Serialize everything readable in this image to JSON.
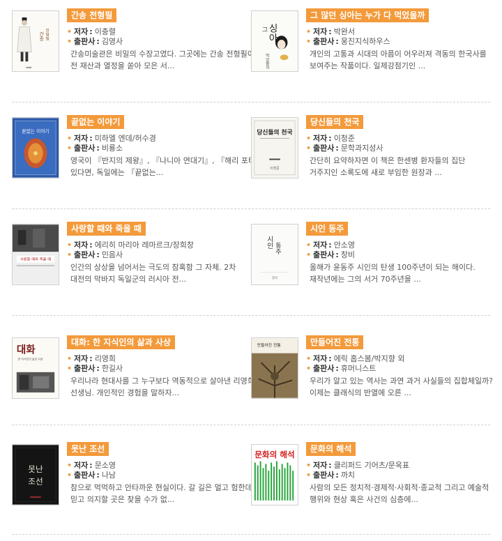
{
  "labels": {
    "author": "저자",
    "publisher": "출판사"
  },
  "books": [
    {
      "title": "간송 전형필",
      "author": "이충렬",
      "publisher": "김영사",
      "desc": [
        "간송미술관은 비밀의 수장고였다. 그곳에는 간송 전형필이",
        "전 재산과 열정을 쏟아 모은 서..."
      ],
      "cover": {
        "type": "gansong",
        "text": "간송 전형필"
      }
    },
    {
      "title": "그 많던 싱아는 누가 다 먹었을까",
      "author": "박완서",
      "publisher": "웅진지식하우스",
      "desc": [
        "개인의 고통과 시대의 아픔이 어우러져 격동의 한국사를",
        "보여주는 작품이다. 일제강점기인 ..."
      ],
      "cover": {
        "type": "singa",
        "text": "싱아"
      }
    },
    {
      "title": "끝없는 이야기",
      "author": "미하엘 엔데/허수경",
      "publisher": "비룡소",
      "desc": [
        "영국이 『반지의 제왕』, 『나니아 연대기』, 『해리 포터』가",
        "있다면, 독일에는 『끝없는..."
      ],
      "cover": {
        "type": "endless",
        "text": "끝없는 이야기"
      }
    },
    {
      "title": "당신들의 천국",
      "author": "이청준",
      "publisher": "문학과지성사",
      "desc": [
        "간단히 요약하자면 이 책은 한센병 환자들의 집단",
        "거주지인 소록도에 새로 부임한 원장과 ..."
      ],
      "cover": {
        "type": "heaven",
        "text": "당신들의 천국"
      }
    },
    {
      "title": "사랑할 때와 죽을 때",
      "author": "에리히 마리아 레마르크/장희창",
      "publisher": "민음사",
      "desc": [
        "인간의 상상을 넘어서는 극도의 참혹함 그 자체. 2차",
        "대전의 막바지 독일군의 러시아 전..."
      ],
      "cover": {
        "type": "love",
        "text": "사랑할 때와 죽을 때"
      }
    },
    {
      "title": "시인 동주",
      "author": "안소영",
      "publisher": "창비",
      "desc": [
        "올해가 윤동주 시인의 탄생 100주년이 되는 해이다.",
        "재작년에는 그의 서거 70주년을 ..."
      ],
      "cover": {
        "type": "poet",
        "text": "시인 동주"
      }
    },
    {
      "title": "대화: 한 지식인의 삶과 사상",
      "author": "리영희",
      "publisher": "한길사",
      "desc": [
        "우리나라 현대사를 그 누구보다 역동적으로 살아낸 리영희",
        "선생님. 개인적인 경험을 말하자..."
      ],
      "cover": {
        "type": "dialogue",
        "text": "대화"
      }
    },
    {
      "title": "만들어진 전통",
      "author": "에릭 홉스봄/박지향 외",
      "publisher": "휴머니스트",
      "desc": [
        "우리가 알고 있는 역사는 과연 과거 사실들의 집합체일까?",
        "이제는 클래식의 반열에 오른 ..."
      ],
      "cover": {
        "type": "tradition",
        "text": "만들어진 전통"
      }
    },
    {
      "title": "못난 조선",
      "author": "문소영",
      "publisher": "나남",
      "desc": [
        "참으로 먹먹하고 안타까운 현실이다. 갈 길은 멀고 험한데",
        "믿고 의지할 곳은 찾을 수가 없..."
      ],
      "cover": {
        "type": "joseon",
        "text": "못난 조선"
      }
    },
    {
      "title": "문화의 해석",
      "author": "클리퍼드 기어츠/문옥표",
      "publisher": "까치",
      "desc": [
        "사람의 모든 정치적·경제적·사회적·종교적 그리고 예술적",
        "행위와 현상 혹은 사건의 심층에..."
      ],
      "cover": {
        "type": "culture",
        "text": "문화의 해석"
      }
    }
  ],
  "colors": {
    "accent": "#f39a3b"
  }
}
